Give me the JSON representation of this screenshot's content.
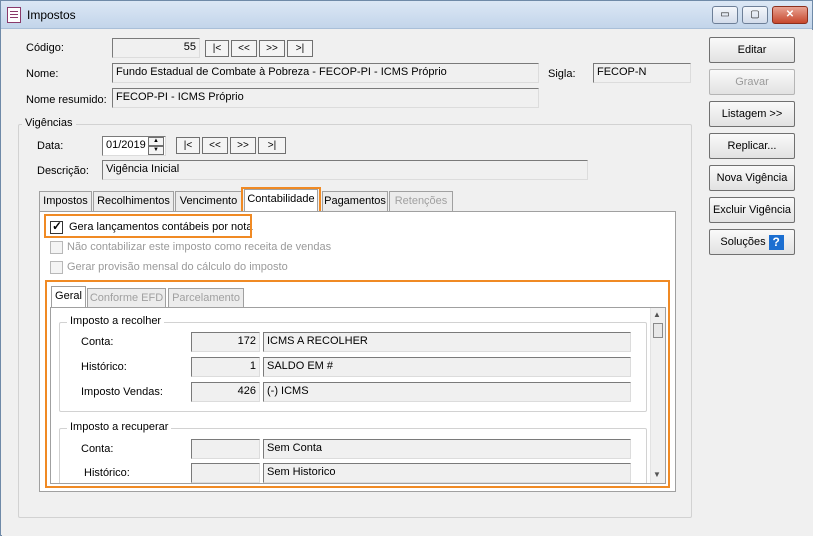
{
  "window": {
    "title": "Impostos",
    "controls": {
      "minimize": "▭",
      "maximize": "▢",
      "close": "✕"
    }
  },
  "form": {
    "codigo_label": "Código:",
    "codigo_value": "55",
    "nav": [
      "|<",
      "<<",
      ">>",
      ">|"
    ],
    "nome_label": "Nome:",
    "nome_value": "Fundo Estadual de Combate à Pobreza - FECOP-PI - ICMS Próprio",
    "sigla_label": "Sigla:",
    "sigla_value": "FECOP-N",
    "nome_resumido_label": "Nome resumido:",
    "nome_resumido_value": "FECOP-PI - ICMS Próprio"
  },
  "vigencias": {
    "title": "Vigências",
    "data_label": "Data:",
    "data_value": "01/2019",
    "nav": [
      "|<",
      "<<",
      ">>",
      ">|"
    ],
    "descricao_label": "Descrição:",
    "descricao_value": "Vigência Inicial"
  },
  "tabs": [
    "Impostos",
    "Recolhimentos",
    "Vencimento",
    "Contabilidade",
    "Pagamentos",
    "Retenções"
  ],
  "contabilidade": {
    "chk1": "Gera lançamentos contábeis por nota",
    "chk2": "Não contabilizar este imposto como receita de vendas",
    "chk3": "Gerar provisão mensal do cálculo do imposto",
    "subtabs": [
      "Geral",
      "Conforme EFD",
      "Parcelamento"
    ],
    "recolher": {
      "title": "Imposto a recolher",
      "conta_label": "Conta:",
      "conta_code": "172",
      "conta_desc": "ICMS A RECOLHER",
      "historico_label": "Histórico:",
      "historico_code": "1",
      "historico_desc": "SALDO EM #",
      "vendas_label": "Imposto Vendas:",
      "vendas_code": "426",
      "vendas_desc": "(-) ICMS"
    },
    "recuperar": {
      "title": "Imposto a recuperar",
      "conta_label": "Conta:",
      "conta_desc": "Sem Conta",
      "historico_label": "Histórico:",
      "historico_desc": "Sem Historico"
    }
  },
  "side_buttons": {
    "editar": "Editar",
    "gravar": "Gravar",
    "listagem": "Listagem >>",
    "replicar": "Replicar...",
    "nova": "Nova Vigência",
    "excluir": "Excluir Vigência",
    "solucoes": "Soluções",
    "help": "?"
  },
  "scroll": {
    "up": "▲",
    "down": "▼"
  },
  "accent_color": "#f08a24"
}
